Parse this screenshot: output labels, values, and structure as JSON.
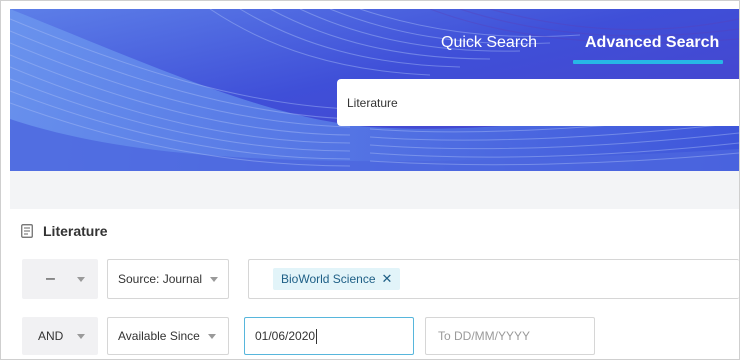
{
  "tabs": {
    "quick_label": "Quick Search",
    "advanced_label": "Advanced Search",
    "active": "advanced"
  },
  "search": {
    "value": "Literature"
  },
  "section": {
    "title": "Literature",
    "icon": "document-icon"
  },
  "row1": {
    "operator": "–",
    "field": "Source: Journal",
    "chips": [
      "BioWorld Science"
    ]
  },
  "row2": {
    "operator": "AND",
    "field": "Available Since",
    "from_value": "01/06/2020",
    "to_placeholder": "To DD/MM/YYYY"
  },
  "colors": {
    "hero": "#3f4fd8",
    "accent": "#27b7e6",
    "chip_bg": "#e2f4f9",
    "chip_text": "#1e5f86"
  }
}
